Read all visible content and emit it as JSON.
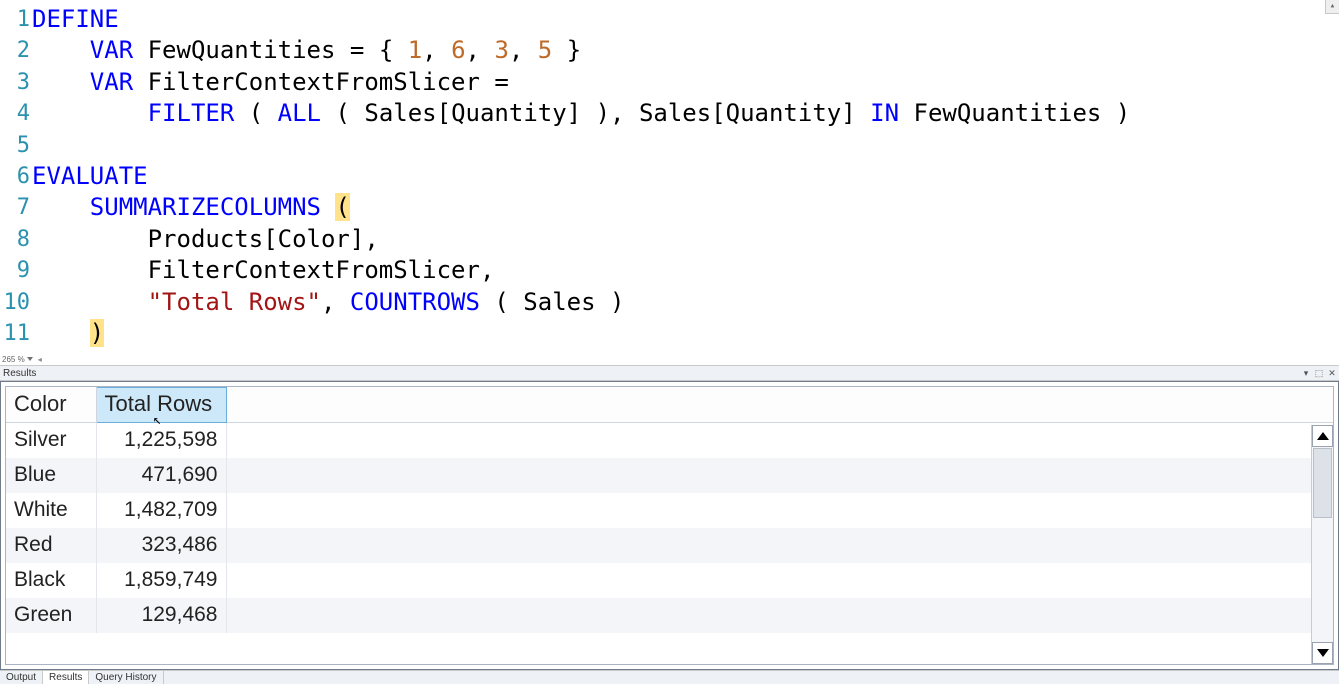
{
  "editor": {
    "zoom_label": "265 %",
    "lines": [
      {
        "n": 1
      },
      {
        "n": 2
      },
      {
        "n": 3
      },
      {
        "n": 4
      },
      {
        "n": 5
      },
      {
        "n": 6
      },
      {
        "n": 7
      },
      {
        "n": 8
      },
      {
        "n": 9
      },
      {
        "n": 10
      },
      {
        "n": 11
      }
    ],
    "tokens": {
      "define": "DEFINE",
      "var": "VAR",
      "evaluate": "EVALUATE",
      "filter": "FILTER",
      "all": "ALL",
      "summarize": "SUMMARIZECOLUMNS",
      "countrows": "COUNTROWS",
      "in": "IN",
      "fewq_name": "FewQuantities",
      "fctx_name": "FilterContextFromSlicer",
      "eq": " = ",
      "set_open": "{ ",
      "set_close": " }",
      "n1": "1",
      "n6": "6",
      "n3": "3",
      "n5": "5",
      "comma_sp": ", ",
      "paren_o_sp": " ( ",
      "paren_c_sp": " )",
      "paren_o": "(",
      "paren_c": ")",
      "sales_qty": "Sales[Quantity]",
      "prod_color": "Products[Color]",
      "sales": "Sales",
      "str_total_rows": "\"Total Rows\""
    }
  },
  "results": {
    "panel_title": "Results",
    "columns": [
      {
        "key": "color",
        "label": "Color"
      },
      {
        "key": "total",
        "label": "Total Rows"
      }
    ],
    "rows": [
      {
        "color": "Silver",
        "total": "1,225,598"
      },
      {
        "color": "Blue",
        "total": "471,690"
      },
      {
        "color": "White",
        "total": "1,482,709"
      },
      {
        "color": "Red",
        "total": "323,486"
      },
      {
        "color": "Black",
        "total": "1,859,749"
      },
      {
        "color": "Green",
        "total": "129,468"
      }
    ]
  },
  "tabs": {
    "output": "Output",
    "results": "Results",
    "query_history": "Query History"
  }
}
